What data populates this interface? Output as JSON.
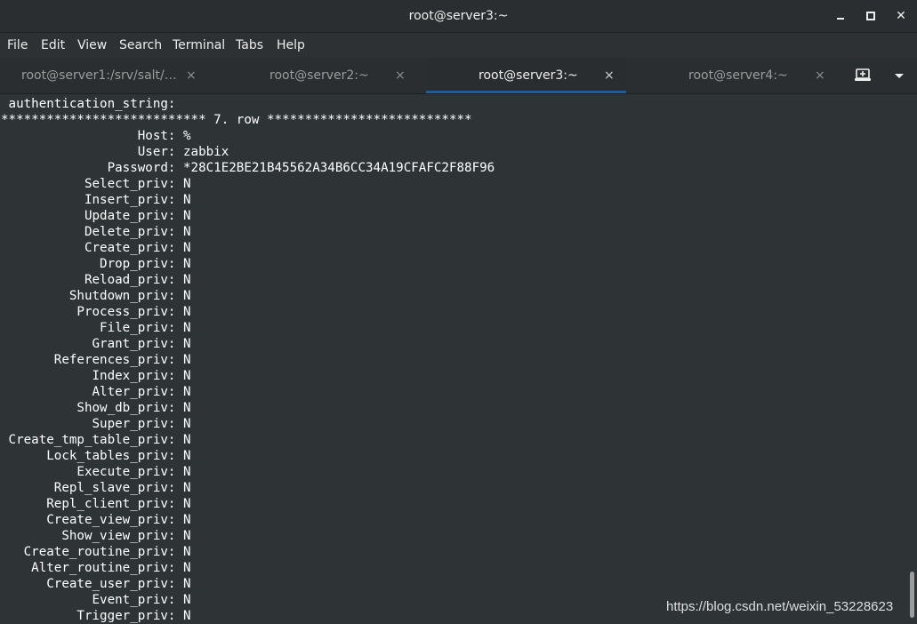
{
  "window": {
    "title": "root@server3:~",
    "minimize_icon": "minimize-icon",
    "maximize_icon": "maximize-icon",
    "close_icon": "close-icon",
    "close_glyph": "✕"
  },
  "menu": [
    "File",
    "Edit",
    "View",
    "Search",
    "Terminal",
    "Tabs",
    "Help"
  ],
  "tabs": [
    {
      "label": "root@server1:/srv/salt/…",
      "close": "×",
      "active": false
    },
    {
      "label": "root@server2:~",
      "close": "×",
      "active": false
    },
    {
      "label": "root@server3:~",
      "close": "×",
      "active": true
    },
    {
      "label": "root@server4:~",
      "close": "×",
      "active": false
    }
  ],
  "colors": {
    "background": "#2e3436",
    "active_tab_underline": "#215d9c",
    "text": "#ffffff"
  },
  "terminal_lines": [
    " authentication_string: ",
    "*************************** 7. row ***************************",
    "                  Host: %",
    "                  User: zabbix",
    "              Password: *28C1E2BE21B45562A34B6CC34A19CFAFC2F88F96",
    "           Select_priv: N",
    "           Insert_priv: N",
    "           Update_priv: N",
    "           Delete_priv: N",
    "           Create_priv: N",
    "             Drop_priv: N",
    "           Reload_priv: N",
    "         Shutdown_priv: N",
    "          Process_priv: N",
    "             File_priv: N",
    "            Grant_priv: N",
    "       References_priv: N",
    "            Index_priv: N",
    "            Alter_priv: N",
    "          Show_db_priv: N",
    "            Super_priv: N",
    " Create_tmp_table_priv: N",
    "      Lock_tables_priv: N",
    "          Execute_priv: N",
    "       Repl_slave_priv: N",
    "      Repl_client_priv: N",
    "      Create_view_priv: N",
    "        Show_view_priv: N",
    "   Create_routine_priv: N",
    "    Alter_routine_priv: N",
    "      Create_user_priv: N",
    "            Event_priv: N",
    "          Trigger_priv: N"
  ],
  "watermark": "https://blog.csdn.net/weixin_53228623"
}
